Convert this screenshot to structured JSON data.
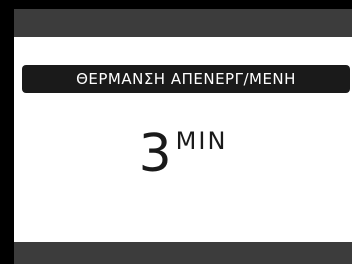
{
  "status": {
    "heating_label": "ΘΕΡΜΑΝΣΗ ΑΠΕΝΕΡΓ/ΜΕΝΗ"
  },
  "timer": {
    "value": "3",
    "unit": "MIN"
  },
  "colors": {
    "background": "#000000",
    "bars": "#3c3c3c",
    "panel": "#ffffff",
    "banner": "#1a1a1a",
    "banner_text": "#ffffff",
    "timer_text": "#1a1a1a"
  }
}
